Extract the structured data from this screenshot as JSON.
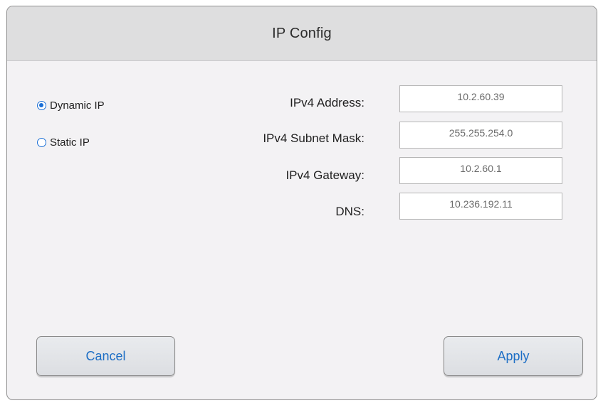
{
  "dialog": {
    "title": "IP Config"
  },
  "mode": {
    "options": [
      {
        "label": "Dynamic IP",
        "selected": true
      },
      {
        "label": "Static IP",
        "selected": false
      }
    ]
  },
  "fields": [
    {
      "label": "IPv4 Address:",
      "value": "10.2.60.39"
    },
    {
      "label": "IPv4 Subnet Mask:",
      "value": "255.255.254.0"
    },
    {
      "label": "IPv4 Gateway:",
      "value": "10.2.60.1"
    },
    {
      "label": "DNS:",
      "value": "10.236.192.11"
    }
  ],
  "buttons": {
    "cancel_label": "Cancel",
    "apply_label": "Apply"
  },
  "colors": {
    "accent": "#1a6fd6",
    "header_bg": "#dededf",
    "body_bg": "#f3f2f4"
  }
}
